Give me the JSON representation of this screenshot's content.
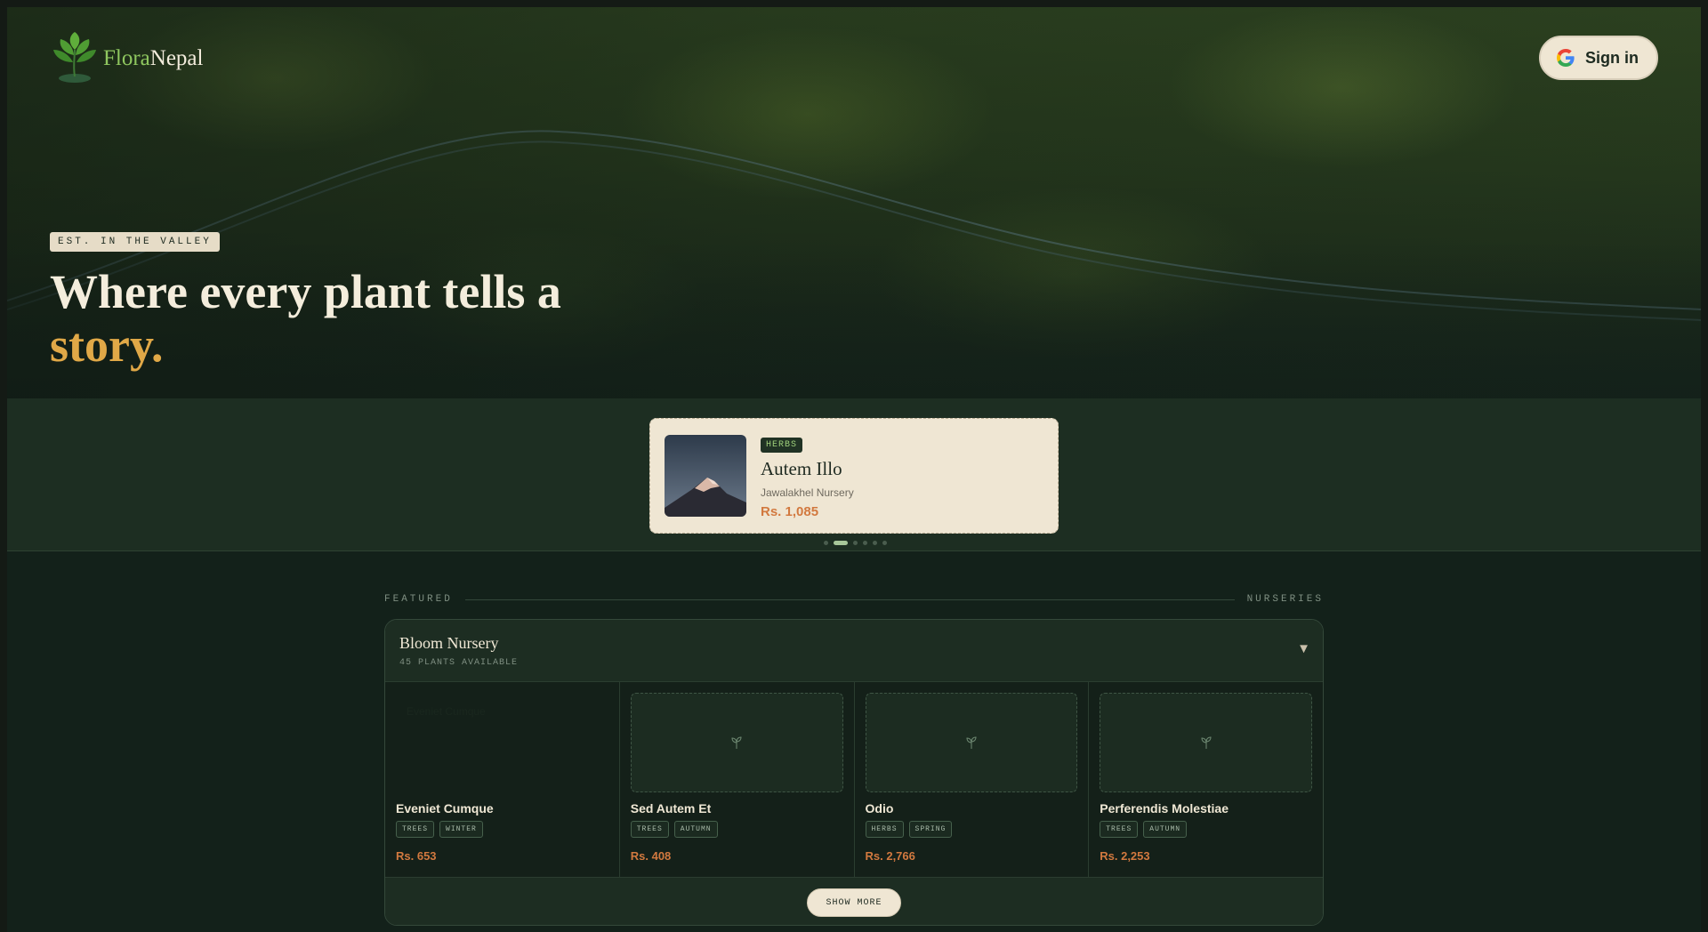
{
  "brand": {
    "part1": "Flora",
    "part2": "Nepal"
  },
  "header": {
    "signin_label": "Sign in"
  },
  "hero": {
    "badge": "EST. IN THE VALLEY",
    "headline_line1": "Where every plant tells a",
    "headline_line2": "story."
  },
  "carousel": {
    "tag": "HERBS",
    "title": "Autem Illo",
    "nursery": "Jawalakhel Nursery",
    "price": "Rs. 1,085",
    "slide_count": 6,
    "active_slide": 2
  },
  "featured": {
    "left_label": "FEATURED",
    "right_label": "NURSERIES"
  },
  "nursery": {
    "name": "Bloom Nursery",
    "count_label": "45 PLANTS AVAILABLE",
    "chevron": "▼",
    "plants": [
      {
        "name": "Eveniet Cumque",
        "tags": [
          "TREES",
          "WINTER"
        ],
        "price": "Rs. 653",
        "image_text": "Eveniet Cumque"
      },
      {
        "name": "Sed Autem Et",
        "tags": [
          "TREES",
          "AUTUMN"
        ],
        "price": "Rs. 408"
      },
      {
        "name": "Odio",
        "tags": [
          "HERBS",
          "SPRING"
        ],
        "price": "Rs. 2,766"
      },
      {
        "name": "Perferendis Molestiae",
        "tags": [
          "TREES",
          "AUTUMN"
        ],
        "price": "Rs. 2,253"
      }
    ],
    "show_more_label": "SHOW MORE"
  },
  "colors": {
    "accent_gold": "#e0a847",
    "price_orange": "#d2793f",
    "cream": "#efe6d3",
    "forest": "#1d2d22"
  }
}
